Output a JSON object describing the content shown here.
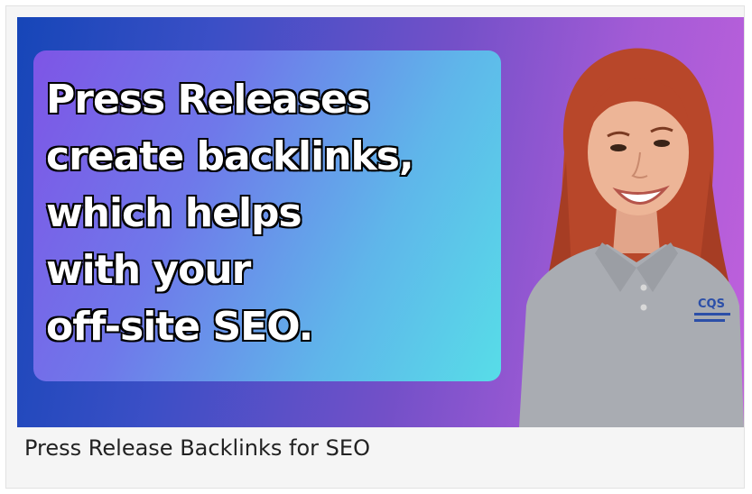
{
  "video": {
    "headline_lines": [
      "Press Releases",
      "create backlinks,",
      "which helps",
      "with your",
      "off-site SEO."
    ],
    "shirt_logo_text": "CQS",
    "caption": "Press Release Backlinks for SEO"
  },
  "colors": {
    "gradient_left": "#1646b8",
    "gradient_right": "#c060dc",
    "panel_left": "#7e55e6",
    "panel_right": "#57dde8",
    "hair": "#b8472a",
    "shirt": "#a9acb2"
  }
}
